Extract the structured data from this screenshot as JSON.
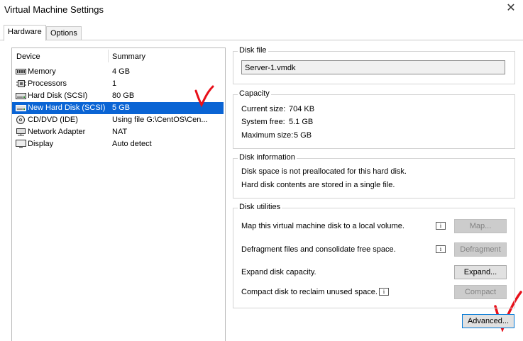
{
  "window": {
    "title": "Virtual Machine Settings",
    "close_glyph": "✕"
  },
  "tabs": [
    {
      "label": "Hardware",
      "active": true
    },
    {
      "label": "Options",
      "active": false
    }
  ],
  "device_list": {
    "headers": {
      "device": "Device",
      "summary": "Summary"
    },
    "rows": [
      {
        "icon": "memory-icon",
        "device": "Memory",
        "summary": "4 GB"
      },
      {
        "icon": "processor-icon",
        "device": "Processors",
        "summary": "1"
      },
      {
        "icon": "hard-disk-icon",
        "device": "Hard Disk (SCSI)",
        "summary": "80 GB"
      },
      {
        "icon": "hard-disk-icon",
        "device": "New Hard Disk (SCSI)",
        "summary": "5 GB",
        "selected": true
      },
      {
        "icon": "cd-dvd-icon",
        "device": "CD/DVD (IDE)",
        "summary": "Using file G:\\CentOS\\Cen..."
      },
      {
        "icon": "network-adapter-icon",
        "device": "Network Adapter",
        "summary": "NAT"
      },
      {
        "icon": "display-icon",
        "device": "Display",
        "summary": "Auto detect"
      }
    ]
  },
  "disk_file": {
    "label": "Disk file",
    "value": "Server-1.vmdk"
  },
  "capacity": {
    "label": "Capacity",
    "current_size_label": "Current size:",
    "current_size": "704 KB",
    "system_free_label": "System free:",
    "system_free": "5.1 GB",
    "maximum_size_label": "Maximum size:",
    "maximum_size": "5 GB"
  },
  "disk_information": {
    "label": "Disk information",
    "line1": "Disk space is not preallocated for this hard disk.",
    "line2": "Hard disk contents are stored in a single file."
  },
  "disk_utilities": {
    "label": "Disk utilities",
    "map_text": "Map this virtual machine disk to a local volume.",
    "map_button": "Map...",
    "defrag_text": "Defragment files and consolidate free space.",
    "defrag_button": "Defragment",
    "expand_text": "Expand disk capacity.",
    "expand_button": "Expand...",
    "compact_text": "Compact disk to reclaim unused space.",
    "compact_button": "Compact",
    "info_glyph": "i"
  },
  "advanced_button": "Advanced...",
  "colors": {
    "selection": "#0a64d4",
    "annotation": "#e8101a",
    "group_border": "#d4d4d4"
  }
}
